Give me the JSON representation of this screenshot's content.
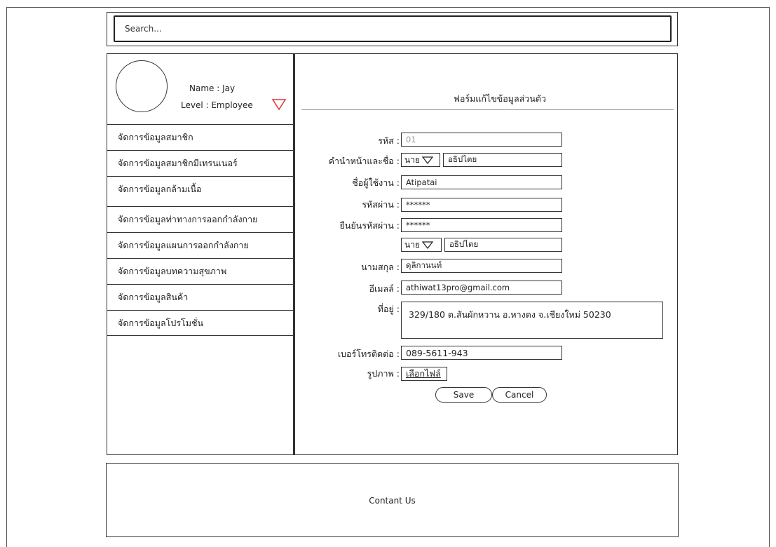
{
  "search": {
    "placeholder": "Search..."
  },
  "user": {
    "name_line": "Name : Jay",
    "level_line": "Level : Employee"
  },
  "menu": [
    "จัดการข้อมูลสมาชิก",
    "จัดการข้อมูลสมาชิกมีเทรนเนอร์",
    "จัดการข้อมูลกล้ามเนื้อ",
    "จัดการข้อมูลท่าทางการออกกำลังกาย",
    "จัดการข้อมูลแผนการออกกำลังกาย",
    "จัดการข้อมูลบทความสุขภาพ",
    "จัดการข้อมูลสินค้า",
    "จัดการข้อมูลโปรโมชั่น"
  ],
  "form": {
    "title": "ฟอร์มแก้ไขข้อมูลส่วนตัว",
    "id_label": "รหัส :",
    "id_value": "01",
    "title_name_label": "คำนำหน้าและชื่อ :",
    "prefix_value": "นาย",
    "first_name_value": "อธิปไตย",
    "username_label": "ชื่อผู้ใช้งาน :",
    "username_value": "Atipatai",
    "password_label": "รหัสผ่าน :",
    "password_value": "******",
    "confirm_label": "ยืนยันรหัสผ่าน :",
    "confirm_value": "******",
    "prefix2_value": "นาย",
    "name2_value": "อธิปไตย",
    "surname_label": "นามสกุล :",
    "surname_value": "ดุลิกานนท์",
    "email_label": "อีเมลล์ :",
    "email_value": "athiwat13pro@gmail.com",
    "address_label": "ที่อยู่ :",
    "address_value": "329/180 ต.สันผักหวาน อ.หางดง จ.เชียงใหม่ 50230",
    "phone_label": "เบอร์โทรติดต่อ :",
    "phone_value": "089-5611-943",
    "photo_label": "รูปภาพ :",
    "file_button": "เลือกไฟล์",
    "save": "Save",
    "cancel": "Cancel"
  },
  "footer": {
    "contact": "Contant Us"
  },
  "colors": {
    "accent": "#e03030"
  },
  "icons": {
    "user_menu": "triangle-down-icon",
    "select": "triangle-down-icon"
  }
}
